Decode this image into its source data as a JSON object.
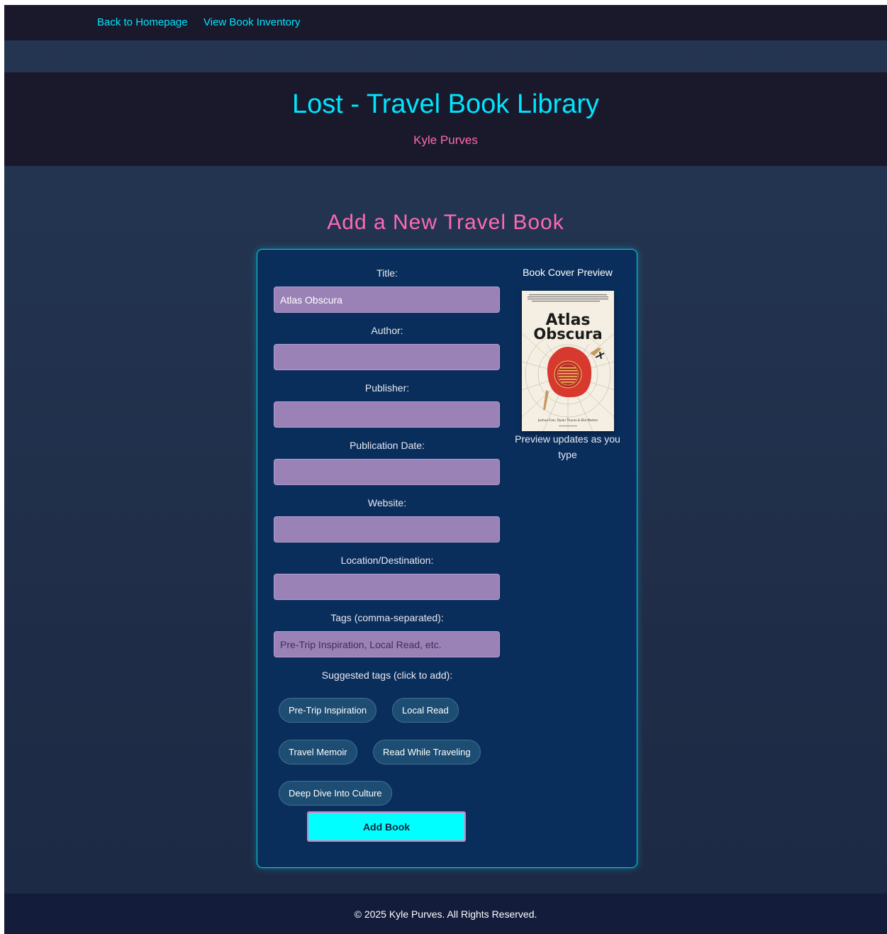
{
  "nav": {
    "home_label": "Back to Homepage",
    "inventory_label": "View Book Inventory"
  },
  "header": {
    "title": "Lost - Travel Book Library",
    "author": "Kyle Purves"
  },
  "form": {
    "heading": "Add a New Travel Book",
    "fields": [
      {
        "label": "Title:",
        "value": "Atlas Obscura",
        "placeholder": ""
      },
      {
        "label": "Author:",
        "value": "",
        "placeholder": ""
      },
      {
        "label": "Publisher:",
        "value": "",
        "placeholder": ""
      },
      {
        "label": "Publication Date:",
        "value": "",
        "placeholder": ""
      },
      {
        "label": "Website:",
        "value": "",
        "placeholder": ""
      },
      {
        "label": "Location/Destination:",
        "value": "",
        "placeholder": ""
      },
      {
        "label": "Tags (comma-separated):",
        "value": "",
        "placeholder": "Pre-Trip Inspiration, Local Read, etc."
      }
    ],
    "suggested_label": "Suggested tags (click to add):",
    "tags": [
      "Pre-Trip Inspiration",
      "Local Read",
      "Travel Memoir",
      "Read While Traveling",
      "Deep Dive Into Culture"
    ],
    "submit_label": "Add Book"
  },
  "preview": {
    "title": "Book Cover Preview",
    "note": "Preview updates as you type",
    "cover": {
      "blurb": "„Ich dachte, ich hätte die meisten interessanten Orte der Welt bereits gesehen. Atlas Obscura hat mir gezeigt, dass ich damit falsch lag. Eine wunderbare Lektüre, lecker und immer wieder.\" — Neil Gaiman",
      "title_line1": "Atlas",
      "title_line2": "Obscura",
      "center_text": "Eine Entdeckungsreise zu den verborgenen Wundern der Welt",
      "authors": "Joshua Foer, Dylan Thuras & Ella Morton"
    }
  },
  "footer": {
    "text": "© 2025 Kyle Purves. All Rights Reserved."
  },
  "colors": {
    "accent_cyan": "#00e5ff",
    "accent_pink": "#ff69b4",
    "input_bg": "#9b82b6",
    "card_bg": "#0a2e5c"
  }
}
